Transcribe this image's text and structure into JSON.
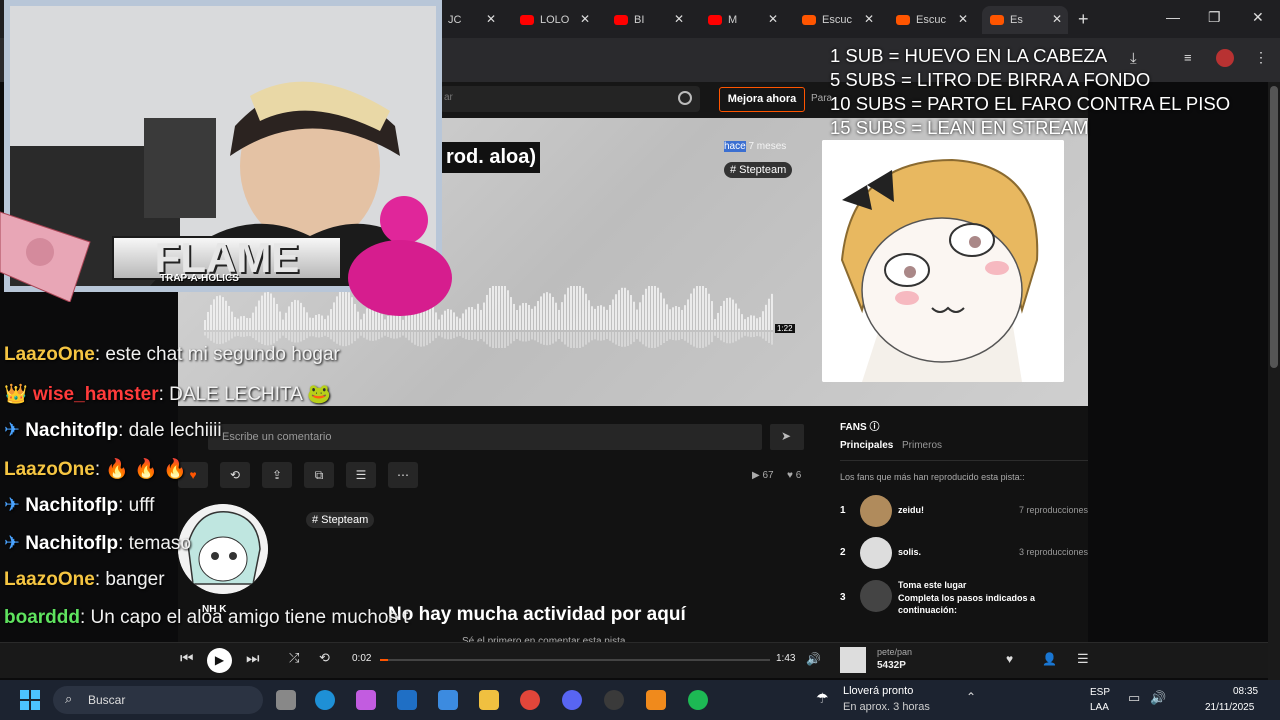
{
  "browser": {
    "tabs": [
      {
        "label": "JC",
        "color": "#ff0000"
      },
      {
        "label": "LOLO",
        "color": "#ff0000"
      },
      {
        "label": "BI",
        "color": "#ff0000"
      },
      {
        "label": "M",
        "color": "#ff0000"
      },
      {
        "label": "Escuc",
        "color": "#ff5500"
      },
      {
        "label": "Escuc",
        "color": "#ff5500"
      },
      {
        "label": "Es",
        "color": "#ff5500"
      }
    ],
    "new_tab": "+",
    "minimize": "—",
    "maximize": "❐",
    "close": "✕"
  },
  "page": {
    "search_placeholder": "ar",
    "upgrade_label": "Mejora ahora",
    "upgrade_next": "Para",
    "track_title": "rod. aloa)",
    "posted_prefix": "hace",
    "posted_rest": " 7 meses",
    "hero_tag": "# Stepteam",
    "wave_time": "1:22",
    "comment_placeholder": "Escribe un comentario",
    "stats_plays": "▶ 67",
    "stats_likes": "♥ 6",
    "tag": "# Stepteam",
    "uploader": "NH K",
    "empty_title": "No hay mucha actividad por aquí",
    "empty_sub": "Sé el primero en comentar esta pista"
  },
  "fans": {
    "heading": "FANS ⓘ",
    "tabs": [
      "Principales",
      "Primeros"
    ],
    "description": "Los fans que más han reproducido esta pista::",
    "rows": [
      {
        "rank": "1",
        "name": "zeidu!",
        "plays": "7 reproducciones"
      },
      {
        "rank": "2",
        "name": "solis.",
        "plays": "3 reproducciones"
      },
      {
        "rank": "3",
        "name": "Toma este lugar",
        "plays": "Completa los pasos indicados a continuación:"
      }
    ]
  },
  "overlay": {
    "rules": [
      "1 SUB = HUEVO EN LA CABEZA",
      "5 SUBS = LITRO DE BIRRA A FONDO",
      "10 SUBS = PARTO EL FARO CONTRA EL PISO",
      "15 SUBS = LEAN EN STREAM"
    ],
    "banner": "FLAME",
    "banner_sub": "TRAP-A-HOLICS"
  },
  "chat": [
    {
      "user": "LaazoOne",
      "text": "este chat mi segundo hogar",
      "color": "#f5c542",
      "badge": ""
    },
    {
      "user": "wise_hamster",
      "text": "DALE LECHITA 🐸",
      "color": "#ff3b3b",
      "badge": "👑"
    },
    {
      "user": "Nachitoflp",
      "text": "dale lechiiii",
      "color": "#ffffff",
      "badge": "✈"
    },
    {
      "user": "LaazoOne",
      "text": "🔥 🔥 🔥",
      "color": "#f5c542",
      "badge": ""
    },
    {
      "user": "Nachitoflp",
      "text": "ufff",
      "color": "#ffffff",
      "badge": "✈"
    },
    {
      "user": "Nachitoflp",
      "text": "temaso",
      "color": "#ffffff",
      "badge": "✈"
    },
    {
      "user": "LaazoOne",
      "text": "banger",
      "color": "#f5c542",
      "badge": ""
    },
    {
      "user": "boarddd",
      "text": "Un capo el aloa amigo tiene muchos t",
      "color": "#5fe35f",
      "badge": ""
    }
  ],
  "player": {
    "current": "0:02",
    "duration": "1:43",
    "progress": 0.02,
    "np_user": "pete/pan",
    "np_title": "5432P"
  },
  "taskbar": {
    "search": "Buscar",
    "weather_title": "Lloverá pronto",
    "weather_sub": "En aprox. 3 horas",
    "lang1": "ESP",
    "lang2": "LAA",
    "time": "08:35",
    "date": "21/11/2025"
  },
  "colors": {
    "accent": "#ff5500",
    "bg": "#121212"
  }
}
